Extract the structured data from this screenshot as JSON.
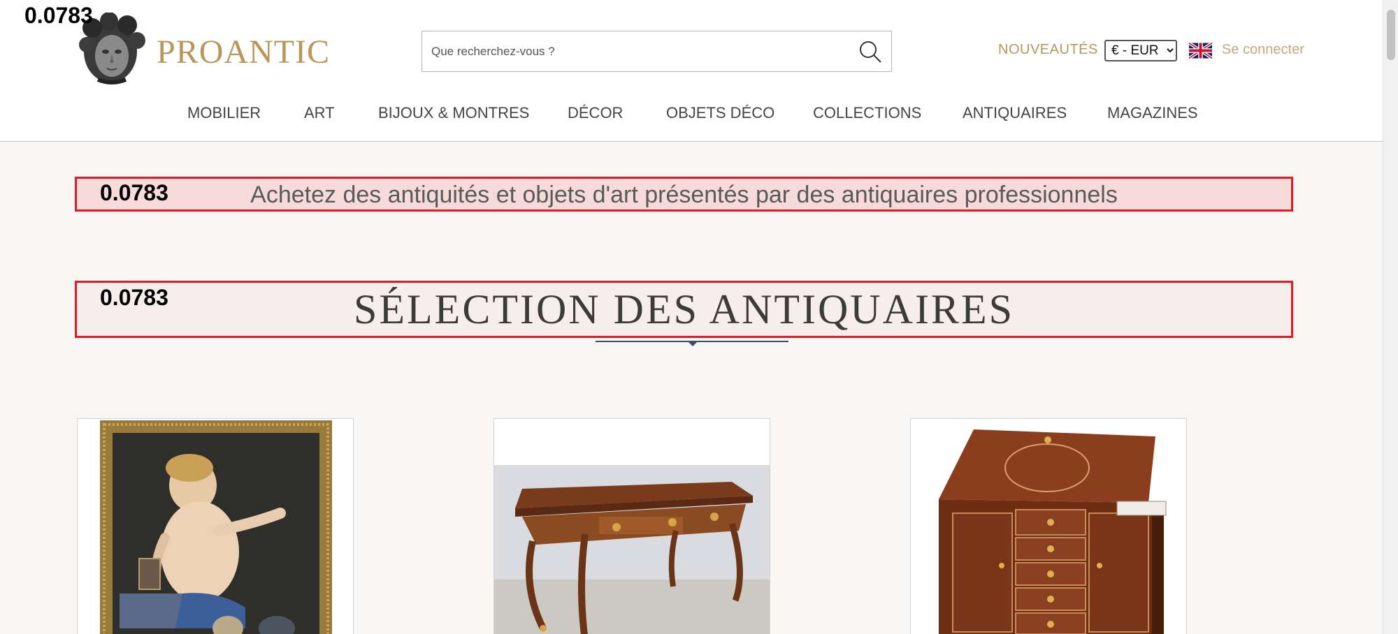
{
  "debug_values": [
    "0.0783",
    "0.0783",
    "0.0783"
  ],
  "header": {
    "logo_text": "PROANTIC",
    "search_placeholder": "Que recherchez-vous ?",
    "nouveautes": "NOUVEAUTÉS",
    "currency": "€ - EUR",
    "login": "Se connecter"
  },
  "nav": [
    "MOBILIER",
    "ART",
    "BIJOUX & MONTRES",
    "DÉCOR",
    "OBJETS DÉCO",
    "COLLECTIONS",
    "ANTIQUAIRES",
    "MAGAZINES"
  ],
  "tagline": "Achetez des antiquités et objets d'art présentés par des antiquaires professionnels",
  "section_title": "SÉLECTION DES ANTIQUAIRES",
  "colors": {
    "gold": "#b9975b",
    "highlight_border": "#e31b23",
    "divider": "#3a4e6a"
  }
}
